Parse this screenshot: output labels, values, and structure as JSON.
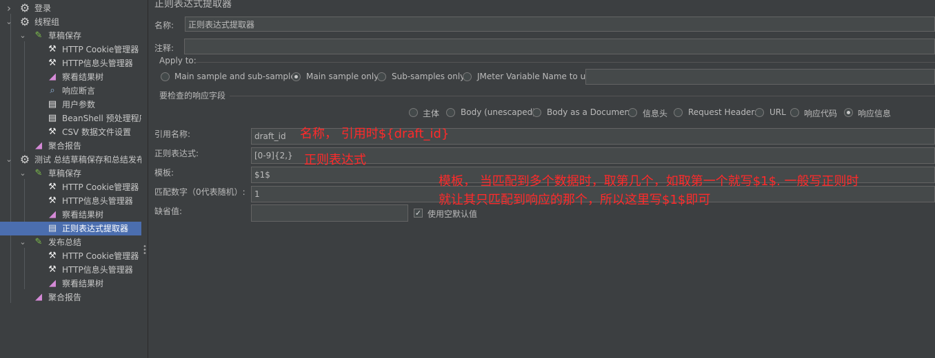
{
  "tree": {
    "items": [
      {
        "label": "登录",
        "icon": "gear-icon"
      },
      {
        "label": "线程组",
        "icon": "gear-icon"
      },
      {
        "label": "草稿保存",
        "icon": "pencil-icon"
      },
      {
        "label": "HTTP Cookie管理器",
        "icon": "tools-icon"
      },
      {
        "label": "HTTP信息头管理器",
        "icon": "tools-icon"
      },
      {
        "label": "察看结果树",
        "icon": "chart-icon"
      },
      {
        "label": "响应断言",
        "icon": "magnifier-icon"
      },
      {
        "label": "用户参数",
        "icon": "document-icon"
      },
      {
        "label": "BeanShell 预处理程序",
        "icon": "document-icon"
      },
      {
        "label": "CSV 数据文件设置",
        "icon": "tools-icon"
      },
      {
        "label": "聚合报告",
        "icon": "chart-icon"
      },
      {
        "label": "测试 总结草稿保存和总结发布",
        "icon": "gear-icon"
      },
      {
        "label": "草稿保存",
        "icon": "pencil-icon"
      },
      {
        "label": "HTTP Cookie管理器",
        "icon": "tools-icon"
      },
      {
        "label": "HTTP信息头管理器",
        "icon": "tools-icon"
      },
      {
        "label": "察看结果树",
        "icon": "chart-icon"
      },
      {
        "label": "正则表达式提取器",
        "icon": "document-icon"
      },
      {
        "label": "发布总结",
        "icon": "pencil-icon"
      },
      {
        "label": "HTTP Cookie管理器",
        "icon": "tools-icon"
      },
      {
        "label": "HTTP信息头管理器",
        "icon": "tools-icon"
      },
      {
        "label": "察看结果树",
        "icon": "chart-icon"
      },
      {
        "label": "聚合报告",
        "icon": "chart-icon"
      }
    ],
    "selected_index": 16
  },
  "panel": {
    "title": "正则表达式提取器",
    "name_label": "名称:",
    "name_value": "正则表达式提取器",
    "comment_label": "注释:",
    "comment_value": "",
    "apply_to": {
      "label": "Apply to:",
      "options": [
        "Main sample and sub-samples",
        "Main sample only",
        "Sub-samples only",
        "JMeter Variable Name to use"
      ],
      "selected": "Main sample only",
      "variable_value": ""
    },
    "field_to_check": {
      "label": "要检查的响应字段",
      "options": [
        "主体",
        "Body (unescaped)",
        "Body as a Document",
        "信息头",
        "Request Headers",
        "URL",
        "响应代码",
        "响应信息"
      ],
      "selected": "响应信息"
    },
    "ref_name_label": "引用名称:",
    "ref_name_value": "draft_id",
    "regex_label": "正则表达式:",
    "regex_value": "[0-9]{2,}",
    "template_label": "模板:",
    "template_value": "$1$",
    "match_no_label": "匹配数字（0代表随机）:",
    "match_no_value": "1",
    "default_label": "缺省值:",
    "default_value": "",
    "use_empty_default_label": "使用空默认值",
    "use_empty_default_checked": true
  },
  "annotations": {
    "name_note": "名称，  引用时${draft_id}",
    "regex_note": "正则表达式",
    "template_note_line1": "模板，  当匹配到多个数据时，取第几个，如取第一个就写$1$. 一般写正则时",
    "template_note_line2": "就让其只匹配到响应的那个，所以这里写$1$即可",
    "color": "#ff2a2a"
  },
  "colors": {
    "background": "#3c3f41",
    "selection": "#4b6eaf",
    "field_bg": "#45494a"
  }
}
